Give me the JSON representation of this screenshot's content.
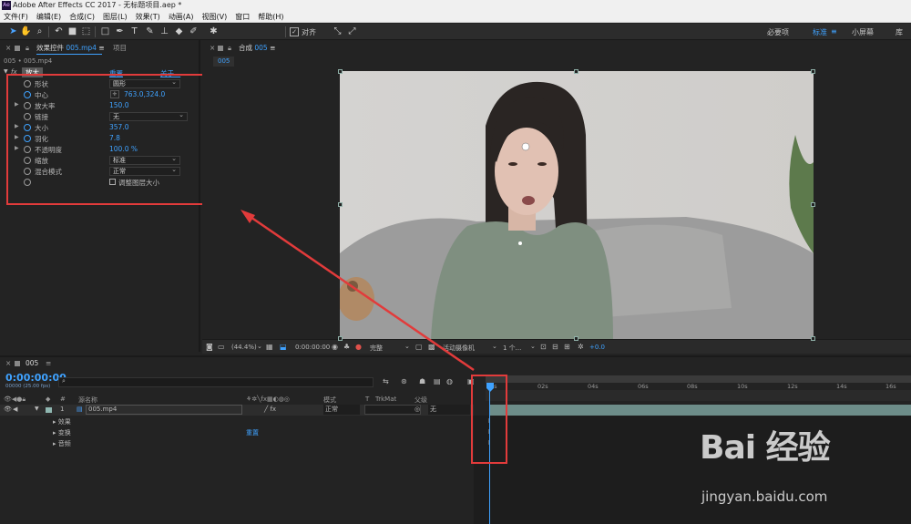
{
  "window": {
    "title": "Adobe After Effects CC 2017 - 无标题项目.aep *",
    "app_logo": "Ae"
  },
  "menu": [
    "文件(F)",
    "编辑(E)",
    "合成(C)",
    "图层(L)",
    "效果(T)",
    "动画(A)",
    "视图(V)",
    "窗口",
    "帮助(H)"
  ],
  "toolbar": {
    "align_label": "对齐",
    "workspaces": [
      "必要项",
      "标准",
      "小屏幕",
      "库"
    ],
    "active_workspace": "标准",
    "icons": [
      "selection-tool",
      "hand-tool",
      "zoom-tool",
      "rotate-tool",
      "camera-tool",
      "pan-behind-tool",
      "rectangle-tool",
      "pen-tool",
      "text-tool",
      "brush-tool",
      "clone-stamp-tool",
      "eraser-tool",
      "roto-brush-tool",
      "puppet-tool"
    ]
  },
  "effects_panel": {
    "tab_label": "效果控件 005.mp4",
    "tab_label_prefix": "效果控件",
    "tab_label_file": "005.mp4",
    "project_tab": "项目",
    "breadcrumb": "005 • 005.mp4",
    "effect_name": "放大",
    "reset_label": "重置",
    "about_label": "关于...",
    "properties": [
      {
        "label": "形状",
        "value": "圆形",
        "kind": "dropdown"
      },
      {
        "label": "中心",
        "value": "763.0,324.0",
        "kind": "point"
      },
      {
        "label": "放大率",
        "value": "150.0",
        "kind": "number"
      },
      {
        "label": "链接",
        "value": "无",
        "kind": "dropdown"
      },
      {
        "label": "大小",
        "value": "357.0",
        "kind": "number"
      },
      {
        "label": "羽化",
        "value": "7.8",
        "kind": "number"
      },
      {
        "label": "不透明度",
        "value": "100.0 %",
        "kind": "number"
      },
      {
        "label": "缩放",
        "value": "标准",
        "kind": "dropdown"
      },
      {
        "label": "混合模式",
        "value": "正常",
        "kind": "dropdown"
      },
      {
        "label": "",
        "value": "调整图层大小",
        "kind": "checkbox"
      }
    ]
  },
  "comp_panel": {
    "tab_label": "合成 005",
    "tab_prefix": "合成",
    "tab_comp": "005",
    "comp_chip": "005",
    "zoom": "(44.4%)",
    "timecode": "0:00:00:00",
    "resolution": "完整",
    "camera": "活动摄像机",
    "views": "1 个...",
    "exposure": "+0.0"
  },
  "timeline": {
    "tab_label": "005",
    "current_time": "0:00:00:00",
    "frame_info": "00000 (25.00 fps)",
    "columns": {
      "source_name": "源名称",
      "mode": "模式",
      "t": "T",
      "trkmat": "TrkMat",
      "parent": "父级"
    },
    "layer": {
      "index": "1",
      "name": "005.mp4",
      "mode": "正常",
      "parent": "无"
    },
    "sublayers": [
      "效果",
      "变换",
      "音频"
    ],
    "reset_label": "重置",
    "ruler_ticks": [
      "0s",
      "02s",
      "04s",
      "06s",
      "08s",
      "10s",
      "12s",
      "14s",
      "16s"
    ]
  },
  "watermark": {
    "brand": "Bai 经验",
    "url": "jingyan.baidu.com"
  },
  "colors": {
    "accent": "#3fa2ff",
    "annotation": "#e23b3b",
    "panel_bg": "#232323"
  }
}
